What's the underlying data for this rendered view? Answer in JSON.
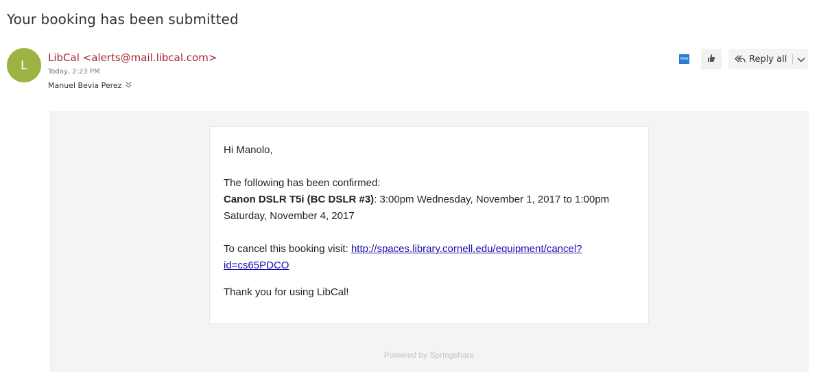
{
  "email": {
    "subject": "Your booking has been submitted",
    "sender_initial": "L",
    "sender": "LibCal <alerts@mail.libcal.com>",
    "timestamp": "Today, 2:23 PM",
    "recipient": "Manuel Bevia Perez",
    "addin_label": "MHA",
    "actions": {
      "reply_all_label": "Reply all"
    }
  },
  "message": {
    "greeting": "Hi Manolo,",
    "intro": "The following has been confirmed:",
    "item_bold": "Canon DSLR T5i (BC DSLR #3)",
    "item_rest": ": 3:00pm Wednesday, November 1, 2017 to 1:00pm Saturday, November 4, 2017",
    "cancel_text": "To cancel this booking visit: ",
    "cancel_link": "http://spaces.library.cornell.edu/equipment/cancel?id=cs65PDCO",
    "closing": "Thank you for using LibCal!",
    "footer": "Powered by Springshare"
  },
  "colors": {
    "avatar": "#9bb343",
    "sender": "#a4262c",
    "link": "#1a0dab",
    "body_background": "#f4f4f4"
  },
  "icons": [
    "expand-recipients-icon",
    "addin-icon",
    "like-icon",
    "reply-all-icon",
    "chevron-down-icon"
  ]
}
